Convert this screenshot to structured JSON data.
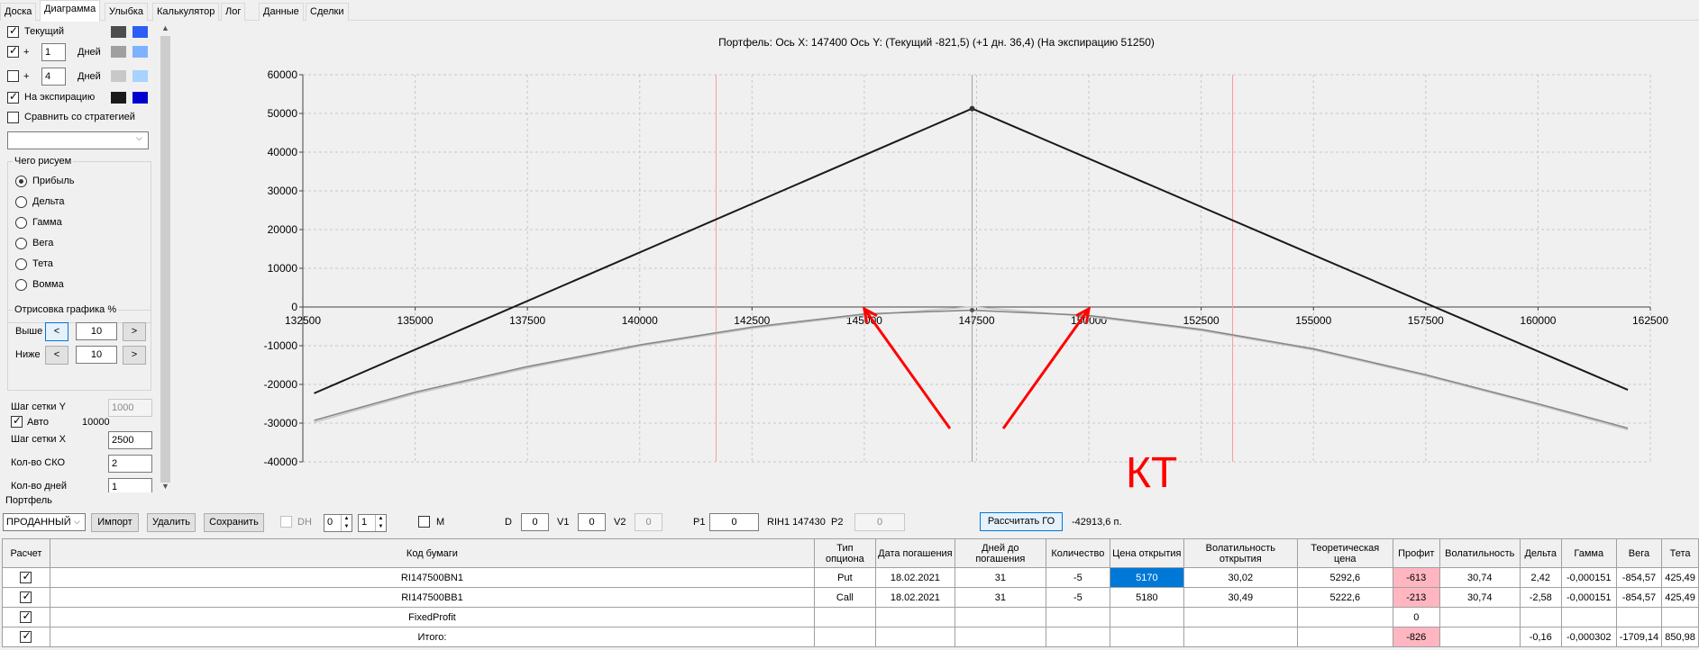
{
  "tabs": [
    "Доска",
    "Диаграмма",
    "Улыбка",
    "Калькулятор",
    "Лог",
    "Данные",
    "Сделки"
  ],
  "active_tab": "Диаграмма",
  "left": {
    "current_label": "Текущий",
    "plus": "+",
    "days_label": "Дней",
    "days1": "1",
    "days2": "4",
    "expiration_label": "На экспирацию",
    "compare_label": "Сравнить со стратегией",
    "compare_value": "",
    "draw_group": "Чего рисуем",
    "radios": [
      "Прибыль",
      "Дельта",
      "Гамма",
      "Вега",
      "Тета",
      "Вомма"
    ],
    "render_group": "Отрисовка графика %",
    "above_label": "Выше",
    "below_label": "Ниже",
    "above_value": "10",
    "below_value": "10",
    "btn_less": "<",
    "btn_more": ">",
    "grid_step_y_label": "Шаг сетки Y",
    "grid_step_y_value": "1000",
    "auto_label": "Авто",
    "auto_value": "10000",
    "grid_step_x_label": "Шаг сетки X",
    "grid_step_x_value": "2500",
    "sko_label": "Кол-во СКО",
    "sko_value": "2",
    "days_count_label": "Кол-во дней",
    "days_count_value": "1",
    "colors": {
      "current_dark": "#4d4d4d",
      "current_blue": "#2a5ef5",
      "d1_dark": "#a0a0a0",
      "d1_blue": "#7fb1ff",
      "d2_dark": "#c8c8c8",
      "d2_blue": "#a6d3ff",
      "exp_dark": "#1a1a1a",
      "exp_blue": "#0000d0"
    }
  },
  "chart": {
    "title": "Портфель:  Ось X:  147400  Ось Y:   (Текущий -821,5)   (+1 дн. 36,4)   (На экспирацию  51250)",
    "annotation": "КТ"
  },
  "chart_data": {
    "type": "line",
    "x_ticks": [
      "132500",
      "135000",
      "137500",
      "140000",
      "142500",
      "145000",
      "147500",
      "150000",
      "152500",
      "155000",
      "157500",
      "160000",
      "162500"
    ],
    "y_ticks": [
      "60000",
      "50000",
      "40000",
      "30000",
      "20000",
      "10000",
      "0",
      "-10000",
      "-20000",
      "-30000",
      "-40000"
    ],
    "xlim": [
      132500,
      162500
    ],
    "ylim": [
      -40000,
      60000
    ],
    "sd_lines_x": [
      141700,
      153200
    ],
    "center_x": 147400,
    "series": [
      {
        "name": "На экспирацию",
        "color": "#1a1a1a",
        "x": [
          132750,
          147400,
          162000
        ],
        "y": [
          -22300,
          51250,
          -21400
        ]
      },
      {
        "name": "Текущий",
        "color": "#888888",
        "x": [
          132750,
          135000,
          137500,
          140000,
          142500,
          145000,
          147400,
          150000,
          152500,
          155000,
          157500,
          160000,
          162000
        ],
        "y": [
          -29300,
          -22000,
          -15400,
          -9800,
          -5200,
          -1800,
          -821,
          -2200,
          -5800,
          -10800,
          -17500,
          -25000,
          -31300
        ]
      },
      {
        "name": "+1 дн.",
        "color": "#c8c8c8",
        "x": [
          132750,
          135000,
          137500,
          140000,
          142500,
          145000,
          147400,
          150000,
          152500,
          155000,
          157500,
          160000,
          162000
        ],
        "y": [
          -29800,
          -22400,
          -15800,
          -10100,
          -5500,
          -2100,
          36,
          -2500,
          -6100,
          -11100,
          -17800,
          -25300,
          -31700
        ]
      }
    ],
    "arrows_to_x": [
      145000,
      150000
    ]
  },
  "portfolio": {
    "label": "Портфель",
    "type_select": "ПРОДАННЫЙ",
    "import_btn": "Импорт",
    "delete_btn": "Удалить",
    "save_btn": "Сохранить",
    "dh_label": "DH",
    "spin1": "0",
    "spin2": "1",
    "m_label": "M",
    "d_label": "D",
    "d_value": "0",
    "v1_label": "V1",
    "v1_value": "0",
    "v2_label": "V2",
    "v2_value": "0",
    "p1_label": "P1",
    "p1_value": "0",
    "ticker_text": "RIH1 147430",
    "p2_label": "P2",
    "p2_value": "0",
    "calc_btn": "Рассчитать ГО",
    "go_value": "-42913,6 п."
  },
  "table": {
    "headers": [
      "Расчет",
      "Код бумаги",
      "Тип опциона",
      "Дата погашения",
      "Дней до погашения",
      "Количество",
      "Цена открытия",
      "Волатильность открытия",
      "Теоретическая цена",
      "Профит",
      "Волатильность",
      "Дельта",
      "Гамма",
      "Вега",
      "Тета"
    ],
    "rows": [
      [
        "",
        "RI147500BN1",
        "Put",
        "18.02.2021",
        "31",
        "-5",
        "5170",
        "30,02",
        "5292,6",
        "-613",
        "30,74",
        "2,42",
        "-0,000151",
        "-854,57",
        "425,49"
      ],
      [
        "",
        "RI147500BB1",
        "Call",
        "18.02.2021",
        "31",
        "-5",
        "5180",
        "30,49",
        "5222,6",
        "-213",
        "30,74",
        "-2,58",
        "-0,000151",
        "-854,57",
        "425,49"
      ],
      [
        "",
        "FixedProfit",
        "",
        "",
        "",
        "",
        "",
        "",
        "",
        "0",
        "",
        "",
        "",
        "",
        ""
      ],
      [
        "",
        "Итого:",
        "",
        "",
        "",
        "",
        "",
        "",
        "",
        "-826",
        "",
        "-0,16",
        "-0,000302",
        "-1709,14",
        "850,98"
      ]
    ]
  }
}
